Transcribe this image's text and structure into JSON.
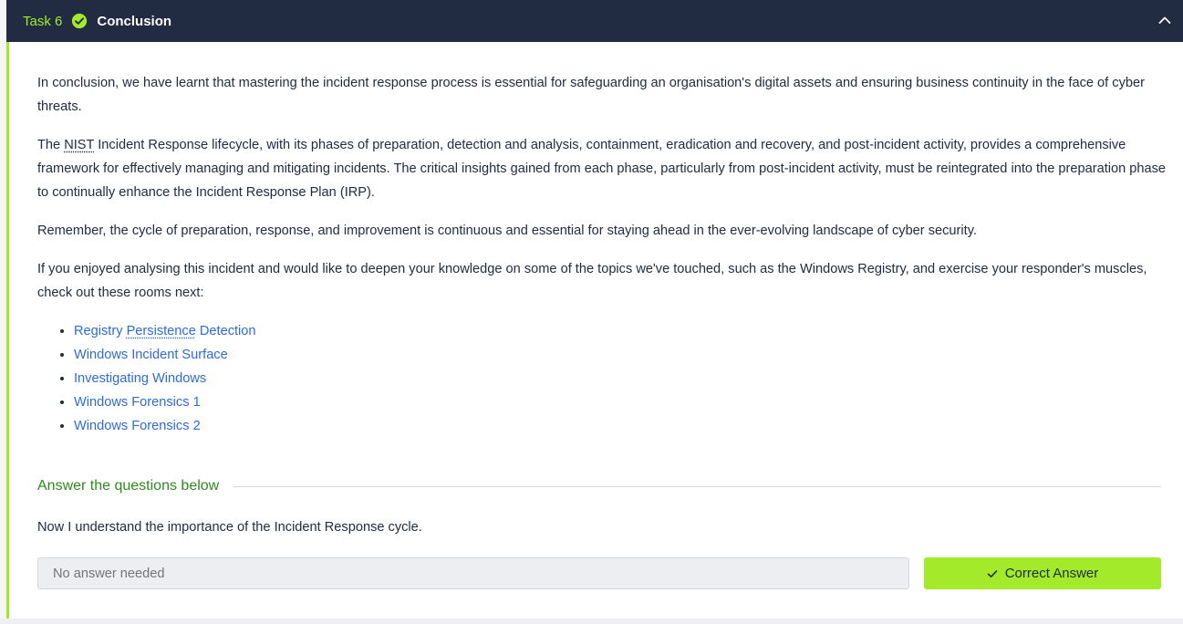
{
  "task": {
    "number_label": "Task 6",
    "title": "Conclusion",
    "completed": true,
    "accent_color": "#a3ea2a"
  },
  "content": {
    "p1": "In conclusion, we have learnt that mastering the incident response process is essential for safeguarding an organisation's digital assets and ensuring business continuity in the face of cyber threats.",
    "p2_prefix": "The ",
    "p2_abbr": "NIST",
    "p2_rest": " Incident Response lifecycle, with its phases of preparation, detection and analysis, containment, eradication and recovery, and post-incident activity, provides a comprehensive framework for effectively managing and mitigating incidents. The critical insights gained from each phase, particularly from post-incident activity, must be reintegrated into the preparation phase to continually enhance the Incident Response Plan (IRP).",
    "p3": "Remember, the cycle of preparation, response, and improvement is continuous and essential for staying ahead in the ever-evolving landscape of cyber security.",
    "p4": "If you enjoyed analysing this incident and would like to deepen your knowledge on some of the topics we've touched, such as the Windows Registry, and exercise your responder's muscles, check out these rooms next:",
    "rooms": [
      {
        "part1": "Registry ",
        "part2": "Persistence",
        "part3": " Detection"
      },
      {
        "label": "Windows Incident Surface"
      },
      {
        "label": "Investigating Windows"
      },
      {
        "label": "Windows Forensics 1"
      },
      {
        "label": "Windows Forensics 2"
      }
    ]
  },
  "answers": {
    "heading": "Answer the questions below",
    "question": "Now I understand the importance of the Incident Response cycle.",
    "input_placeholder": "No answer needed",
    "button_label": "Correct Answer"
  },
  "icons": {
    "task_status": "check-circle-icon",
    "collapse": "chevron-up-icon",
    "button": "check-icon"
  }
}
